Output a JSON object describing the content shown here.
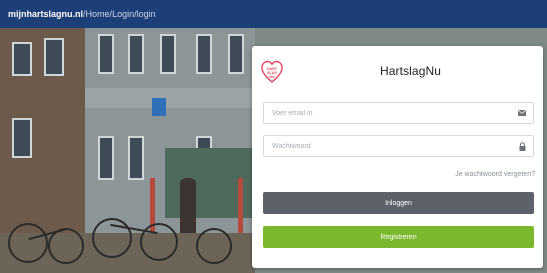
{
  "topbar": {
    "site": "mijnhartslagnu.nl",
    "path_1": "Home",
    "path_2": "Login",
    "path_3": "login",
    "separator": "/"
  },
  "login": {
    "title": "HartslagNu",
    "email_placeholder": "Voer email in",
    "password_placeholder": "Wachtwoord",
    "forgot_label": "Je wachtwoord vergeten?",
    "login_button_label": "Inloggen",
    "register_button_label": "Registreren",
    "logo_text": "HART SLAG NU"
  },
  "colors": {
    "topbar": "#1d3f78",
    "login_button": "#5d6169",
    "register_button": "#7ab82e",
    "logo_accent": "#e2485e"
  },
  "icons": {
    "email": "envelope-icon",
    "password": "lock-icon",
    "logo": "heart-logo-icon"
  }
}
